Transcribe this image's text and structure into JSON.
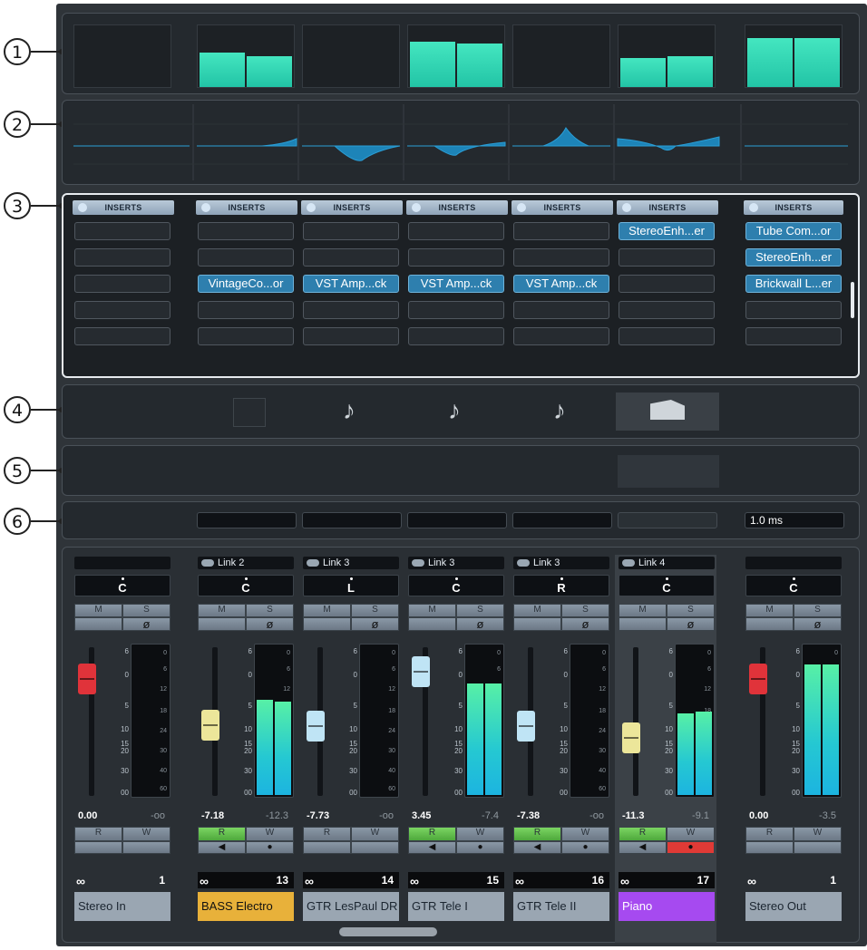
{
  "callouts": [
    "1",
    "2",
    "3",
    "4",
    "5",
    "6"
  ],
  "inserts": {
    "header_label": "INSERTS",
    "columns": [
      {
        "slots": [
          "",
          "",
          "",
          "",
          ""
        ]
      },
      {
        "slots": [
          "",
          "",
          "VintageCo...or",
          "",
          ""
        ]
      },
      {
        "slots": [
          "",
          "",
          "VST Amp...ck",
          "",
          ""
        ]
      },
      {
        "slots": [
          "",
          "",
          "VST Amp...ck",
          "",
          ""
        ]
      },
      {
        "slots": [
          "",
          "",
          "VST Amp...ck",
          "",
          ""
        ]
      },
      {
        "slots": [
          "StereoEnh...er",
          "",
          "",
          "",
          ""
        ]
      },
      {
        "slots": [
          "Tube Com...or",
          "StereoEnh...er",
          "Brickwall L...er",
          "",
          ""
        ]
      }
    ]
  },
  "latency": {
    "output_value": "1.0 ms"
  },
  "fader_scale": [
    "6",
    "0",
    "5",
    "10",
    "15",
    "20",
    "30",
    "00"
  ],
  "meter_scale": [
    "0",
    "6",
    "12",
    "18",
    "24",
    "30",
    "40",
    "60"
  ],
  "mute_label": "M",
  "solo_label": "S",
  "phase_label": "ø",
  "read_label": "R",
  "write_label": "W",
  "channels": [
    {
      "link": "",
      "pan": "C",
      "volume": "0.00",
      "peak": "-oo",
      "number": "1",
      "name": "Stereo In",
      "name_color": "#9aa6b2",
      "rw_active": false,
      "meter_level": 0.0,
      "fader_color": "#e0333a",
      "fader_level": 0.84,
      "meter_levels": [
        0.0,
        0.0
      ],
      "mono_meter": [
        0.0,
        0.0
      ]
    },
    {
      "link": "Link 2",
      "pan": "C",
      "volume": "-7.18",
      "peak": "-12.3",
      "number": "13",
      "name": "BASS Electro",
      "name_color": "#e8b13a",
      "rw_active": true,
      "fader_color": "#ece69a",
      "fader_level": 0.48,
      "meter_levels": [
        0.64,
        0.63
      ]
    },
    {
      "link": "Link 3",
      "pan": "L",
      "volume": "-7.73",
      "peak": "-oo",
      "number": "14",
      "name": "GTR LesPaul DR",
      "name_color": "#9aa6b2",
      "rw_active": false,
      "fader_color": "#bfe4f5",
      "fader_level": 0.47,
      "meter_levels": [
        0.0,
        0.0
      ]
    },
    {
      "link": "Link 3",
      "pan": "C",
      "volume": "3.45",
      "peak": "-7.4",
      "number": "15",
      "name": "GTR Tele I",
      "name_color": "#9aa6b2",
      "rw_active": true,
      "fader_color": "#bfe4f5",
      "fader_level": 0.9,
      "meter_levels": [
        0.75,
        0.75
      ]
    },
    {
      "link": "Link 3",
      "pan": "R",
      "volume": "-7.38",
      "peak": "-oo",
      "number": "16",
      "name": "GTR Tele II",
      "name_color": "#9aa6b2",
      "rw_active": true,
      "fader_color": "#bfe4f5",
      "fader_level": 0.47,
      "meter_levels": [
        0.0,
        0.0
      ]
    },
    {
      "link": "Link 4",
      "pan": "C",
      "volume": "-11.3",
      "peak": "-9.1",
      "number": "17",
      "name": "Piano",
      "name_color": "#a64af0",
      "rw_active": true,
      "fader_color": "#ece69a",
      "fader_level": 0.38,
      "meter_levels": [
        0.55,
        0.56
      ],
      "selected": true
    },
    {
      "link": "",
      "pan": "C",
      "volume": "0.00",
      "peak": "-3.5",
      "number": "1",
      "name": "Stereo Out",
      "name_color": "#9aa6b2",
      "rw_active": false,
      "fader_color": "#e0333a",
      "fader_level": 0.84,
      "meter_levels": [
        0.88,
        0.88
      ]
    }
  ],
  "top_meters": [
    [
      0,
      0
    ],
    [
      0.6,
      0.55
    ],
    [
      0,
      0
    ],
    [
      0.72,
      0.72
    ],
    [
      0.5,
      0.5
    ],
    [
      0.82,
      0.82
    ]
  ],
  "colors": {
    "meter": "#2fd8b6",
    "insert_active": "#2e7fae",
    "record_red": "#e03a36",
    "read_green": "#5fbf4a"
  }
}
